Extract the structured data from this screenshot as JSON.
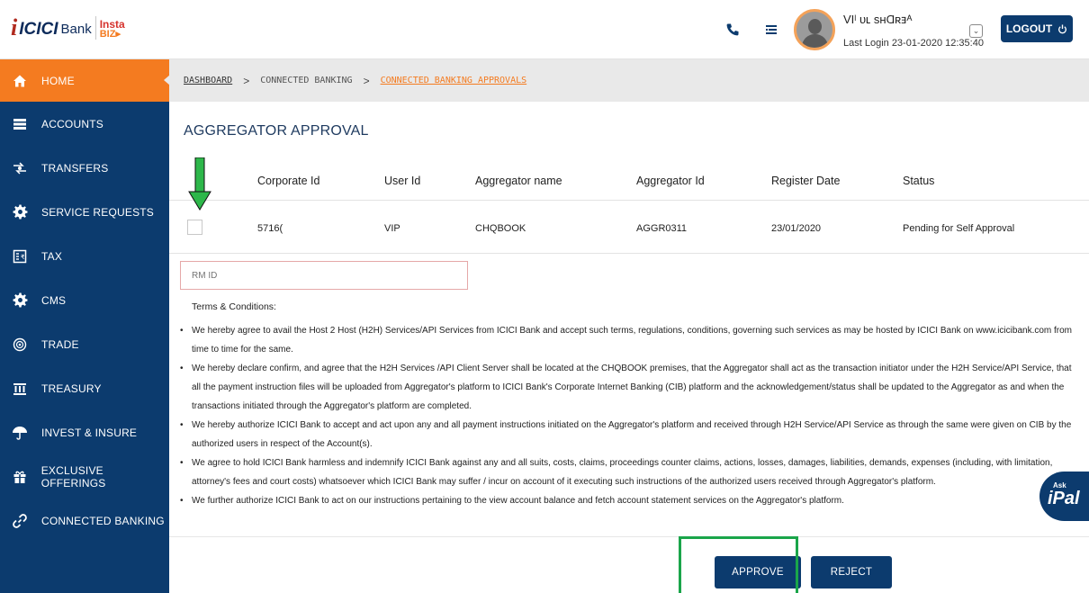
{
  "brand": {
    "logo_mark": "i",
    "logo_icici": "ICICI",
    "logo_bank": "Bank",
    "logo_insta": "Insta",
    "logo_biz": "BIZ▸"
  },
  "header": {
    "user_name": "VIˡ ᴜʟ ѕʜⱭʀⱻᴬ",
    "last_login": "Last Login 23-01-2020 12:35:40",
    "logout_label": "LOGOUT",
    "icons": [
      "phone-icon",
      "menu-list-icon",
      "user-dropdown-icon",
      "power-icon"
    ]
  },
  "sidebar": {
    "items": [
      {
        "label": "HOME",
        "icon": "home-icon",
        "active": true
      },
      {
        "label": "ACCOUNTS",
        "icon": "accounts-icon"
      },
      {
        "label": "TRANSFERS",
        "icon": "transfers-icon"
      },
      {
        "label": "SERVICE REQUESTS",
        "icon": "gear-icon"
      },
      {
        "label": "TAX",
        "icon": "tax-icon"
      },
      {
        "label": "CMS",
        "icon": "gear-icon"
      },
      {
        "label": "TRADE",
        "icon": "globe-icon"
      },
      {
        "label": "TREASURY",
        "icon": "bank-icon"
      },
      {
        "label": "INVEST & INSURE",
        "icon": "umbrella-icon"
      },
      {
        "label": "EXCLUSIVE OFFERINGS",
        "icon": "gift-icon"
      },
      {
        "label": "CONNECTED BANKING",
        "icon": "link-icon"
      }
    ]
  },
  "breadcrumb": {
    "dashboard": "DASHBOARD",
    "connected_banking": "CONNECTED BANKING",
    "current": "CONNECTED BANKING APPROVALS",
    "separator": ">"
  },
  "page_title": "AGGREGATOR APPROVAL",
  "table": {
    "columns": [
      "Corporate Id",
      "User Id",
      "Aggregator name",
      "Aggregator Id",
      "Register Date",
      "Status"
    ],
    "rows": [
      {
        "corporate_id": "5716(",
        "user_id": "VIP",
        "aggregator_name": "CHQBOOK",
        "aggregator_id": "AGGR0311",
        "register_date": "23/01/2020",
        "status": "Pending for Self Approval"
      }
    ]
  },
  "rm_input": {
    "placeholder": "RM ID",
    "value": ""
  },
  "terms": {
    "title": "Terms & Conditions:",
    "bullet": "•",
    "clauses": [
      "We hereby agree to avail the Host 2 Host (H2H) Services/API Services from ICICI Bank and accept such terms, regulations, conditions, governing such services as may be hosted by ICICI Bank on www.icicibank.com from time to time for the same.",
      "We hereby declare confirm, and agree that the H2H Services /API Client Server shall be located at the CHQBOOK premises, that the Aggregator shall act as the transaction initiator under the H2H Service/API Service, that all the payment instruction files will be uploaded from Aggregator's platform to ICICI Bank's Corporate Internet Banking (CIB) platform and the acknowledgement/status shall be updated to the Aggregator as and when the transactions initiated through the Aggregator's platform are completed.",
      "We hereby authorize ICICI Bank to accept and act upon any and all payment instructions initiated on the Aggregator's platform and received through H2H Service/API Service as through the same were given on CIB by the authorized users in respect of the Account(s).",
      "We agree to hold ICICI Bank harmless and indemnify ICICI Bank against any and all suits, costs, claims, proceedings counter claims, actions, losses, damages, liabilities, demands, expenses (including, with limitation, attorney's fees and court costs) whatsoever which ICICI Bank may suffer / incur on account of it executing such instructions of the authorized users received through Aggregator's platform.",
      "We further authorize ICICI Bank to act on our instructions pertaining to the view account balance and fetch account statement services on the Aggregator's platform."
    ]
  },
  "actions": {
    "approve_label": "APPROVE",
    "reject_label": "REJECT"
  },
  "ipal": {
    "ask": "Ask",
    "name": "iPal"
  },
  "colors": {
    "navy": "#0c3b6e",
    "orange": "#f47b20",
    "green_highlight": "#1aa54a",
    "brand_red": "#b02a1e"
  }
}
